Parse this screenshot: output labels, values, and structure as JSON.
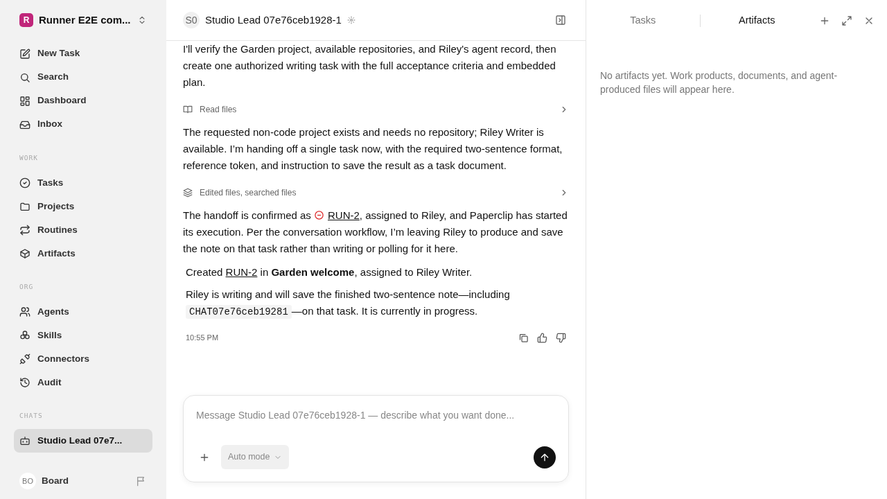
{
  "workspace": {
    "name": "Runner E2E com...",
    "logo_letter": "R"
  },
  "nav": [
    {
      "label": "New Task",
      "selected": false
    },
    {
      "label": "Search",
      "selected": false
    },
    {
      "label": "Dashboard",
      "selected": false
    },
    {
      "label": "Inbox",
      "selected": false
    }
  ],
  "sections": [
    {
      "title": "WORK",
      "items": [
        {
          "label": "Tasks",
          "selected": false
        },
        {
          "label": "Projects",
          "selected": false
        },
        {
          "label": "Routines",
          "selected": false
        },
        {
          "label": "Artifacts",
          "selected": false
        }
      ]
    },
    {
      "title": "ORG",
      "items": [
        {
          "label": "Agents",
          "selected": false
        },
        {
          "label": "Skills",
          "selected": false
        },
        {
          "label": "Connectors",
          "selected": false
        },
        {
          "label": "Audit",
          "selected": false
        }
      ]
    },
    {
      "title": "CHATS",
      "items": [
        {
          "label": "Studio Lead 07e7...",
          "selected": true
        }
      ]
    }
  ],
  "user": {
    "initials": "BO",
    "name": "Board"
  },
  "chat_header": {
    "initials": "S0",
    "title": "Studio Lead 07e76ceb1928-1"
  },
  "messages": [
    {
      "kind": "text",
      "parts": [
        {
          "kind": "text",
          "text": "I'll verify the Garden project, available repositories, and Riley's agent record, then create one authorized writing task with the full acceptance criteria and embedded plan."
        }
      ]
    },
    {
      "kind": "tool",
      "label": "Read files"
    },
    {
      "kind": "text",
      "parts": [
        {
          "kind": "text",
          "text": "The requested non-code project exists and needs no repository; Riley Writer is available. I’m handing off a single task now, with the required two-sentence format, reference token, and instruction to save the result as a task document."
        }
      ]
    },
    {
      "kind": "tool",
      "label": "Edited files, searched files"
    },
    {
      "kind": "text",
      "parts": [
        {
          "kind": "text",
          "text": "The handoff is confirmed as "
        },
        {
          "kind": "link",
          "text": "RUN-2",
          "blocked": true
        },
        {
          "kind": "text",
          "text": ", assigned to Riley, and Paperclip has started its execution. Per the conversation workflow, I’m leaving Riley to produce and save the note on that task rather than writing or polling for it here."
        }
      ]
    },
    {
      "kind": "summary",
      "parts": [
        {
          "kind": "text",
          "text": "Created "
        },
        {
          "kind": "link",
          "text": "RUN-2"
        },
        {
          "kind": "text",
          "text": " in **Garden welcome**, assigned to Riley Writer."
        }
      ]
    },
    {
      "kind": "summary",
      "parts": [
        {
          "kind": "text",
          "text": "Riley is writing and will save the finished two-sentence note—including "
        },
        {
          "kind": "code",
          "text": "CHAT07e76ceb19281"
        },
        {
          "kind": "text",
          "text": "—on that task. It is currently in progress."
        }
      ]
    }
  ],
  "timestamp": "10:55 PM",
  "composer": {
    "placeholder": "Message Studio Lead 07e76ceb1928-1 — describe what you want done...",
    "mode": "Auto mode"
  },
  "panel": {
    "tabs": [
      {
        "label": "Tasks",
        "selected": false
      },
      {
        "label": "Artifacts",
        "selected": true
      }
    ],
    "empty_text": "No artifacts yet. Work products, documents, and agent-produced files will appear here."
  }
}
